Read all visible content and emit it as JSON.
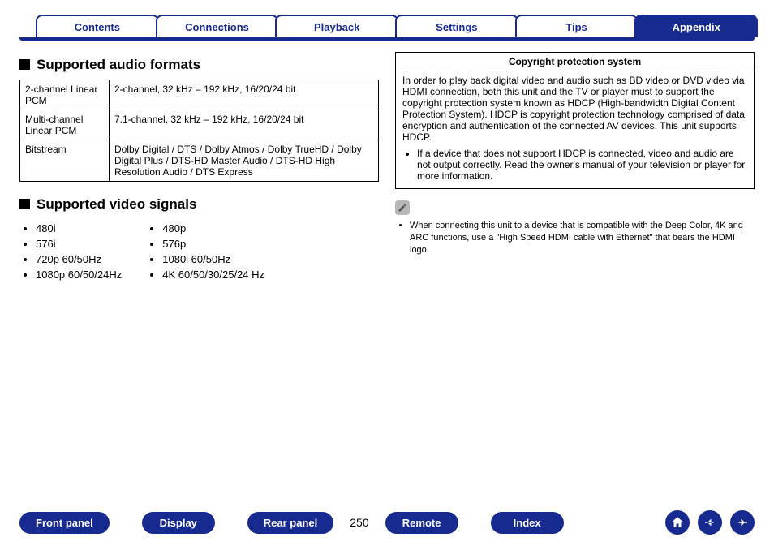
{
  "tabs": [
    {
      "label": "Contents",
      "active": false
    },
    {
      "label": "Connections",
      "active": false
    },
    {
      "label": "Playback",
      "active": false
    },
    {
      "label": "Settings",
      "active": false
    },
    {
      "label": "Tips",
      "active": false
    },
    {
      "label": "Appendix",
      "active": true
    }
  ],
  "left": {
    "audio_heading": "Supported audio formats",
    "audio_rows": [
      {
        "label": "2-channel Linear PCM",
        "value": "2-channel, 32 kHz – 192 kHz, 16/20/24 bit"
      },
      {
        "label": "Multi-channel Linear PCM",
        "value": "7.1-channel, 32 kHz – 192 kHz, 16/20/24 bit"
      },
      {
        "label": "Bitstream",
        "value": "Dolby Digital / DTS / Dolby Atmos / Dolby TrueHD / Dolby Digital Plus / DTS-HD Master Audio / DTS-HD High Resolution Audio / DTS Express"
      }
    ],
    "video_heading": "Supported video signals",
    "video_col1": [
      "480i",
      "576i",
      "720p 60/50Hz",
      "1080p 60/50/24Hz"
    ],
    "video_col2": [
      "480p",
      "576p",
      "1080i 60/50Hz",
      "4K 60/50/30/25/24 Hz"
    ]
  },
  "right": {
    "box_title": "Copyright protection system",
    "box_body": "In order to play back digital video and audio such as BD video or DVD video via HDMI connection, both this unit and the TV or player must to support the copyright protection system known as HDCP (High-bandwidth Digital Content Protection System). HDCP is copyright protection technology comprised of data encryption and authentication of the connected AV devices. This unit supports HDCP.",
    "box_bullet": "If a device that does not support HDCP is connected, video and audio are not output correctly. Read the owner's manual of your television or player for more information.",
    "note_icon": "pencil-icon",
    "small_note": "When connecting this unit to a device that is compatible with the Deep Color, 4K and ARC functions, use a \"High Speed HDMI cable with Ethernet\" that bears the HDMI logo."
  },
  "bottom": {
    "links": [
      "Front panel",
      "Display",
      "Rear panel"
    ],
    "links2": [
      "Remote",
      "Index"
    ],
    "page": "250",
    "icons": [
      "home-icon",
      "arrow-left-icon",
      "arrow-right-icon"
    ]
  }
}
